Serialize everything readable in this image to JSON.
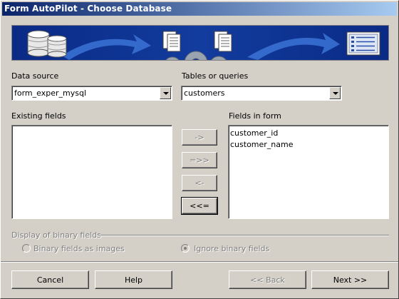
{
  "window": {
    "title": "Form AutoPilot - Choose Database"
  },
  "banner": {
    "icons": [
      "database-cylinders-icon",
      "arrow-right-icon",
      "document-stack-icon",
      "gear-icon",
      "arrow-right-icon",
      "form-list-icon"
    ],
    "colors": {
      "background": "#0b2f8f",
      "arrow": "#3a6fd0",
      "gear": "#9aa3b0"
    }
  },
  "data_source": {
    "label": "Data source",
    "value": "form_exper_mysql"
  },
  "tables": {
    "label": "Tables or queries",
    "value": "customers"
  },
  "existing_fields": {
    "label": "Existing fields",
    "items": []
  },
  "fields_in_form": {
    "label": "Fields in form",
    "items": [
      "customer_id",
      "customer_name"
    ]
  },
  "move_buttons": {
    "add_one": "->",
    "add_all": "=>>",
    "remove_one": "<-",
    "remove_all": "<<="
  },
  "binary": {
    "group_label": "Display of binary fields",
    "option_images": "Binary fields as images",
    "option_ignore": "Ignore binary fields",
    "selected": "ignore"
  },
  "footer": {
    "cancel": "Cancel",
    "help": "Help",
    "back": "<< Back",
    "next": "Next >>"
  }
}
